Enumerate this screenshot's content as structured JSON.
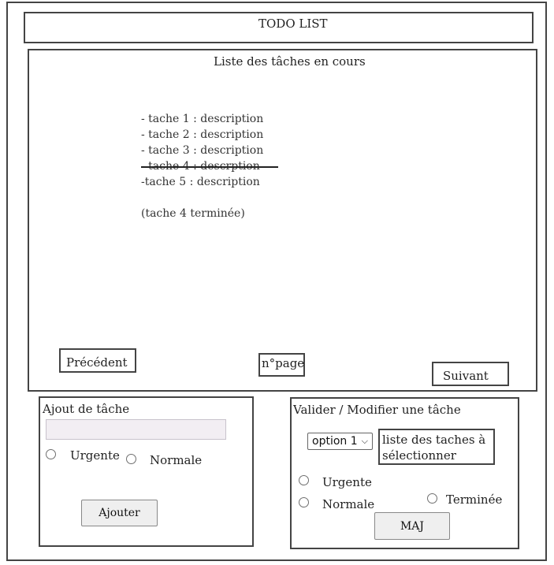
{
  "header": {
    "title": "TODO LIST"
  },
  "task_list": {
    "heading": "Liste des tâches en cours",
    "tasks": [
      {
        "text": "- tache 1 : description",
        "done": false
      },
      {
        "text": "- tache 2 : description",
        "done": false
      },
      {
        "text": "- tache 3 : description",
        "done": false
      },
      {
        "text": "- tache 4  : desc­rption",
        "done": true
      },
      {
        "text": "-tache 5 : description",
        "done": false
      }
    ],
    "note": "(tache 4 terminée)",
    "prev_label": "Précédent",
    "page_label": "n°page",
    "next_label": "Suivant"
  },
  "add_task": {
    "heading": "Ajout de tâche",
    "input_value": "",
    "priority_urgent": "Urgente",
    "priority_normal": "Normale",
    "submit_label": "Ajouter"
  },
  "edit_task": {
    "heading": "Valider / Modifier une tâche",
    "select_value": "option 1",
    "select_hint_line1": "liste des taches à",
    "select_hint_line2": "sélectionner",
    "option_urgent": "Urgente",
    "option_normal": "Normale",
    "option_done": "Terminée",
    "submit_label": "MAJ"
  }
}
